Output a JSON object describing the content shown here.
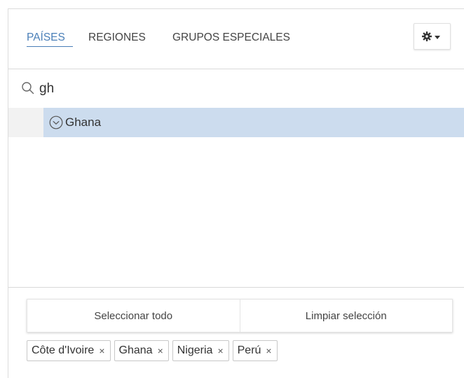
{
  "tabs": [
    {
      "label": "PAÍSES",
      "active": true
    },
    {
      "label": "REGIONES",
      "active": false
    },
    {
      "label": "GRUPOS ESPECIALES",
      "active": false
    }
  ],
  "settings_menu": {
    "icon": "gear-icon",
    "caret": "caret-down-icon"
  },
  "search": {
    "value": "gh",
    "icon": "search-icon"
  },
  "results": [
    {
      "label": "Ghana",
      "selected": true,
      "icon": "check-circle-icon"
    }
  ],
  "actions": {
    "select_all": "Seleccionar todo",
    "clear_selection": "Limpiar selección"
  },
  "selected_chips": [
    {
      "label": "Côte d'Ivoire",
      "remove": "×"
    },
    {
      "label": "Ghana",
      "remove": "×"
    },
    {
      "label": "Nigeria",
      "remove": "×"
    },
    {
      "label": "Perú",
      "remove": "×"
    }
  ],
  "colors": {
    "accent": "#4a7fb8",
    "selected_row": "#ccdcee"
  }
}
